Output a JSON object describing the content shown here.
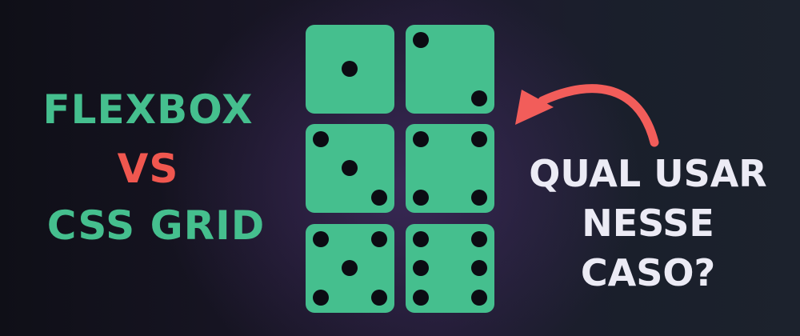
{
  "headline": {
    "line1": "FLEXBOX",
    "line2": "VS",
    "line3": "CSS GRID"
  },
  "question": {
    "line1": "QUAL USAR",
    "line2": "NESSE",
    "line3": "CASO?"
  },
  "dice": [
    {
      "value": 1
    },
    {
      "value": 2
    },
    {
      "value": 3
    },
    {
      "value": 4
    },
    {
      "value": 5
    },
    {
      "value": 6
    }
  ],
  "colors": {
    "background": "#16141f",
    "accent_green": "#45bf8e",
    "vs_red": "#f0574f",
    "arrow_red": "#f25d5a",
    "question_text": "#ecebf5",
    "pip": "#0b0b12"
  },
  "icons": {
    "arrow": "curved-arrow-icon"
  }
}
